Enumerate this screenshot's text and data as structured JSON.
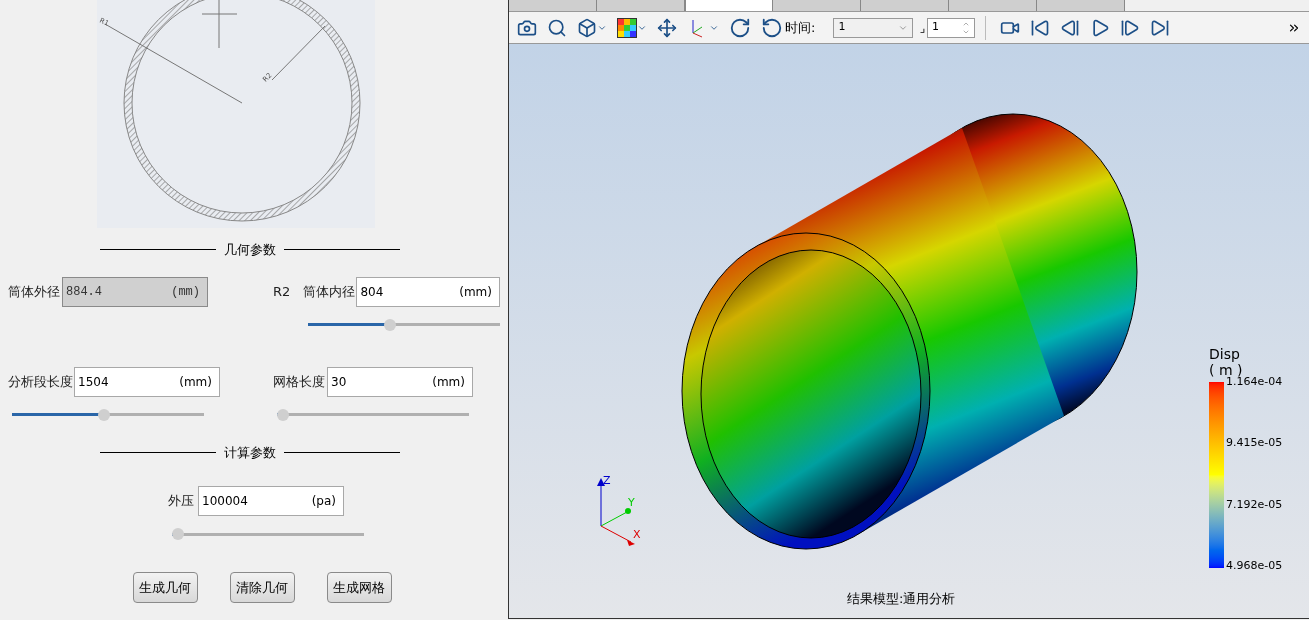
{
  "tabs": [
    {
      "selected": false
    },
    {
      "selected": false
    },
    {
      "selected": true
    },
    {
      "selected": false
    },
    {
      "selected": false
    },
    {
      "selected": false
    },
    {
      "selected": false
    }
  ],
  "sketch": {
    "labels": [
      "R1",
      "R2"
    ]
  },
  "sections": [
    {
      "title": "几何参数",
      "fields": [
        {
          "label": "筒体外径",
          "value": "884.4",
          "unit": "(mm)",
          "disabled": true
        },
        {
          "prefix": "R2",
          "label": "筒体内径",
          "value": "804",
          "unit": "(mm)",
          "disabled": false,
          "level": 0.42
        },
        {
          "label": "分析段长度",
          "value": "1504",
          "unit": "(mm)",
          "disabled": false,
          "level": 0.48
        },
        {
          "label": "网格长度",
          "value": "30",
          "unit": "(mm)",
          "disabled": false,
          "level": 0
        }
      ]
    },
    {
      "title": "计算参数",
      "fields": [
        {
          "label": "外压",
          "value": "100004",
          "unit": "(pa)",
          "disabled": false,
          "level": 0
        }
      ]
    }
  ],
  "buttons": [
    "生成几何",
    "清除几何",
    "生成网格"
  ],
  "toolbar": {
    "time_label": "时间:",
    "time_value": "1",
    "step_glyph": "⌟",
    "step_value": "1"
  },
  "viewport": {
    "caption": "结果模型:通用分析",
    "axes": [
      "Z",
      "Y",
      "X"
    ],
    "legend": {
      "title": "Disp",
      "unit": "( m )",
      "ticks": [
        "1.164e-04",
        "9.415e-05",
        "7.192e-05",
        "4.968e-05"
      ]
    }
  }
}
